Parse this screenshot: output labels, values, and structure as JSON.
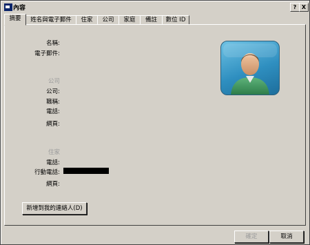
{
  "window": {
    "title": "內容",
    "help_label": "?",
    "close_label": "X"
  },
  "tabs": [
    {
      "label": "摘要"
    },
    {
      "label": "姓名與電子郵件"
    },
    {
      "label": "住家"
    },
    {
      "label": "公司"
    },
    {
      "label": "家庭"
    },
    {
      "label": "備註"
    },
    {
      "label": "數位 ID"
    }
  ],
  "summary": {
    "name_label": "名稱:",
    "email_label": "電子郵件:",
    "company_section": "公司",
    "company_label": "公司:",
    "job_title_label": "職稱:",
    "company_phone_label": "電話:",
    "company_web_label": "網頁:",
    "home_section": "住家",
    "home_phone_label": "電話:",
    "mobile_label": "行動電話:",
    "home_web_label": "網頁:",
    "add_contact_button": "新增到我的連絡人(D)"
  },
  "footer": {
    "ok_label": "確定",
    "cancel_label": "取消"
  },
  "icons": {
    "title": "window-icon",
    "contact": "contact-avatar-icon"
  },
  "colors": {
    "window_bg": "#d4d0c8",
    "section_text": "#9a9a9a",
    "avatar_bg": "#2f8fc0"
  }
}
